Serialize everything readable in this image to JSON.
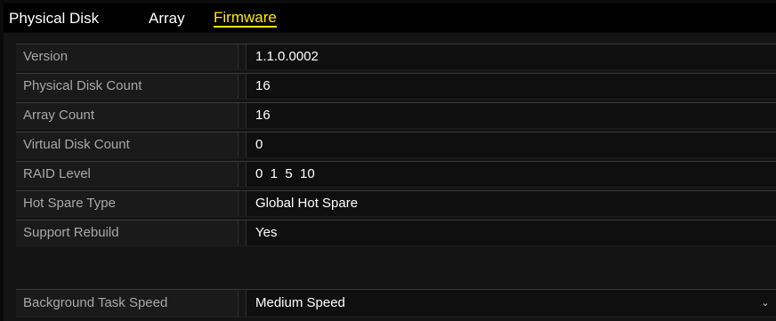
{
  "tabs": [
    {
      "label": "Physical Disk",
      "active": false
    },
    {
      "label": "Array",
      "active": false
    },
    {
      "label": "Firmware",
      "active": true
    }
  ],
  "firmware": {
    "rows": [
      {
        "label": "Version",
        "value": "1.1.0.0002"
      },
      {
        "label": "Physical Disk Count",
        "value": "16"
      },
      {
        "label": "Array Count",
        "value": "16"
      },
      {
        "label": "Virtual Disk Count",
        "value": "0"
      },
      {
        "label": "RAID Level",
        "value": "0  1  5  10"
      },
      {
        "label": "Hot Spare Type",
        "value": "Global Hot Spare"
      },
      {
        "label": "Support Rebuild",
        "value": "Yes"
      }
    ]
  },
  "background_task_speed": {
    "label": "Background Task Speed",
    "value": "Medium Speed",
    "icon": "chevron-down-icon"
  },
  "colors": {
    "active_tab": "#ffea00",
    "label_text": "#a8a8a8",
    "value_text": "#ffffff",
    "background": "#141414"
  }
}
